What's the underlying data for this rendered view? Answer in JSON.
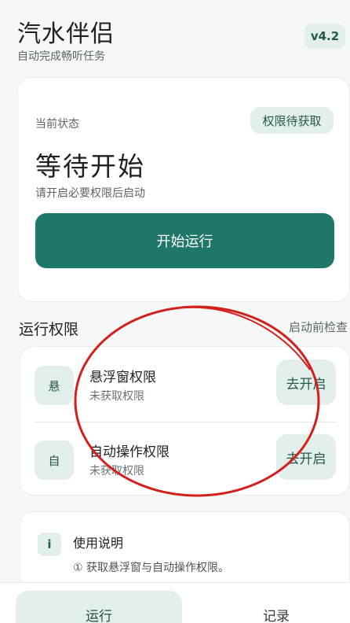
{
  "header": {
    "app_title": "汽水伴侣",
    "app_subtitle": "自动完成畅听任务",
    "version": "v4.2"
  },
  "status_card": {
    "label": "当前状态",
    "permission_pill": "权限待获取",
    "status_title": "等待开始",
    "hint": "请开启必要权限后启动",
    "start_button": "开始运行"
  },
  "permissions_section": {
    "title": "运行权限",
    "action": "启动前检查",
    "items": [
      {
        "icon_text": "悬",
        "name": "悬浮窗权限",
        "state": "未获取权限",
        "action": "去开启"
      },
      {
        "icon_text": "自",
        "name": "自动操作权限",
        "state": "未获取权限",
        "action": "去开启"
      }
    ]
  },
  "help_card": {
    "icon_text": "i",
    "title": "使用说明",
    "step_1": "① 获取悬浮窗与自动操作权限。"
  },
  "bottom_nav": {
    "tabs": [
      {
        "label": "运行",
        "active": true
      },
      {
        "label": "记录",
        "active": false
      }
    ]
  },
  "colors": {
    "accent": "#1f776a",
    "accent_soft": "#e2efeb",
    "annotation": "#d2201d"
  }
}
